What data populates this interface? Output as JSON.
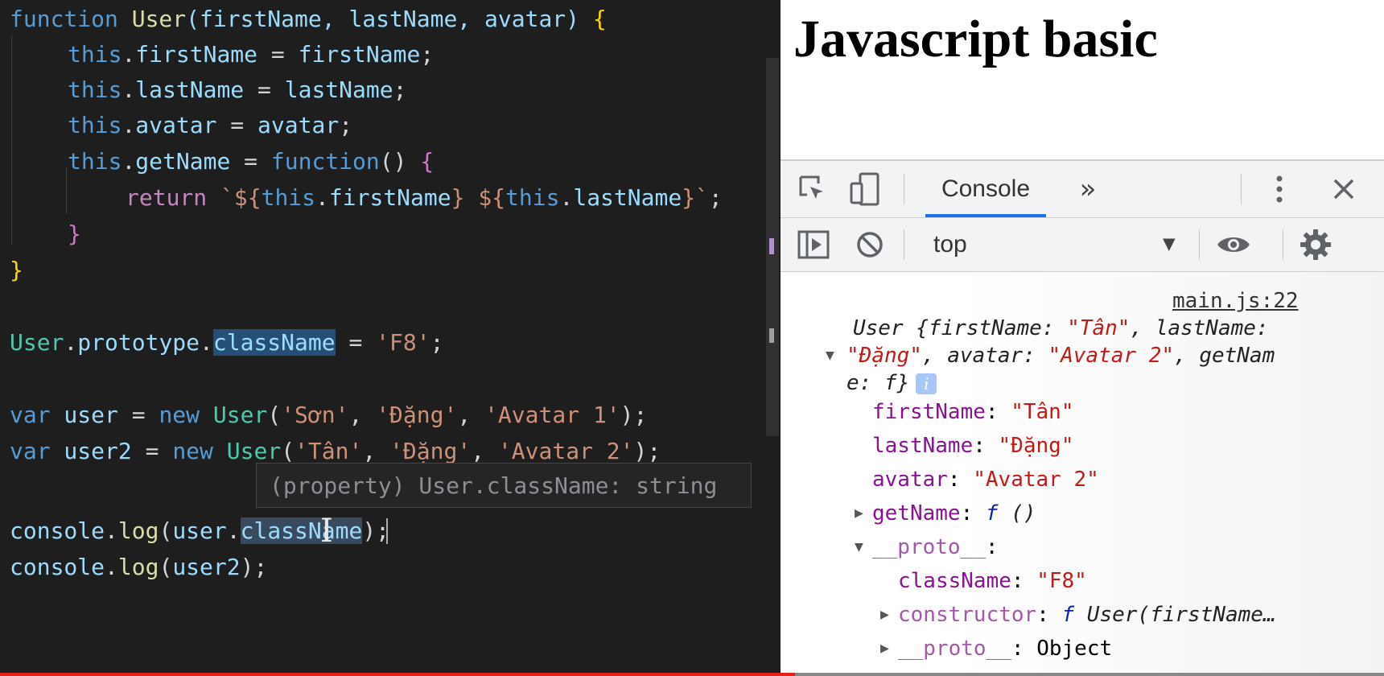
{
  "editor": {
    "lines": {
      "l1": {
        "kw": "function",
        "name": "User",
        "params": "(firstName, lastName, avatar) ",
        "open": "{"
      },
      "l2": {
        "this": "this",
        "dot": ".",
        "prop": "firstName",
        "rest": " = ",
        "val": "firstName",
        "end": ";"
      },
      "l3": {
        "this": "this",
        "dot": ".",
        "prop": "lastName",
        "rest": " = ",
        "val": "lastName",
        "end": ";"
      },
      "l4": {
        "this": "this",
        "dot": ".",
        "prop": "avatar",
        "rest": " = ",
        "val": "avatar",
        "end": ";"
      },
      "l5": {
        "this": "this",
        "dot": ".",
        "prop": "getName",
        "rest": " = ",
        "fn": "function",
        "tail": "() ",
        "open": "{"
      },
      "l6": {
        "ret": "return",
        "sp": " ",
        "tpl1": "`${",
        "this1": "this",
        "dot1": ".",
        "p1": "firstName",
        "tpl2": "} ${",
        "this2": "this",
        "dot2": ".",
        "p2": "lastName",
        "tpl3": "}`",
        "end": ";"
      },
      "l7": {
        "close": "}"
      },
      "l8": {
        "close": "}"
      },
      "l9": {
        "cls": "User",
        "dot1": ".",
        "proto": "prototype",
        "dot2": ".",
        "prop": "className",
        "rest": " = ",
        "val": "'F8'",
        "end": ";"
      },
      "l10": {
        "kw": "var",
        "name": " user",
        "eq": " = ",
        "newkw": "new",
        "cls": " User",
        "open": "(",
        "a1": "'Sơn'",
        "c1": ", ",
        "a2": "'Đặng'",
        "c2": ", ",
        "a3": "'Avatar 1'",
        "close": ");"
      },
      "l11": {
        "kw": "var",
        "name": " user2",
        "eq": " = ",
        "newkw": "new",
        "cls": " User",
        "open": "(",
        "a1": "'Tân'",
        "c1": ", ",
        "a2": "'Đặng'",
        "c2": ", ",
        "a3": "'Avatar 2'",
        "close": ");"
      },
      "l12": {
        "obj": "console",
        "dot1": ".",
        "fn": "log",
        "open": "(",
        "arg": "user",
        "dot2": ".",
        "prop": "className",
        "close": ");"
      },
      "l13": {
        "obj": "console",
        "dot1": ".",
        "fn": "log",
        "open": "(",
        "arg": "user2",
        "close": ");"
      }
    },
    "hover_tooltip": "(property) User.className: string"
  },
  "browser": {
    "page_heading": "Javascript basic",
    "devtools": {
      "active_tab": "Console",
      "more_tabs": "»",
      "context": "top",
      "context_arrow": "▼",
      "source_link": "main.js:22",
      "object_summary": {
        "l1_a": "User {firstName: ",
        "l1_v1": "\"Tân\"",
        "l1_b": ", lastName:",
        "l2_v2": "\"Đặng\"",
        "l2_a": ", avatar: ",
        "l2_v3": "\"Avatar 2\"",
        "l2_b": ", getNam",
        "l3_a": "e: ",
        "l3_f": "f",
        "l3_b": "}"
      },
      "info": "i",
      "props": [
        {
          "key": "firstName",
          "sep": ": ",
          "value": "\"Tân\""
        },
        {
          "key": "lastName",
          "sep": ": ",
          "value": "\"Đặng\""
        },
        {
          "key": "avatar",
          "sep": ": ",
          "value": "\"Avatar 2\""
        }
      ],
      "getName": {
        "key": "getName",
        "sep": ": ",
        "f": "f",
        "sig": " ()"
      },
      "proto": {
        "key": "__proto__",
        "sep": ":"
      },
      "proto_className": {
        "key": "className",
        "sep": ": ",
        "value": "\"F8\""
      },
      "constructor": {
        "key": "constructor",
        "sep": ": ",
        "f": "f",
        "sig": " User(firstName…"
      },
      "proto2": {
        "key": "__proto__",
        "sep": ": ",
        "value": "Object"
      }
    }
  },
  "colors": {
    "accent": "#1a73e8",
    "progress": "#e62117"
  }
}
